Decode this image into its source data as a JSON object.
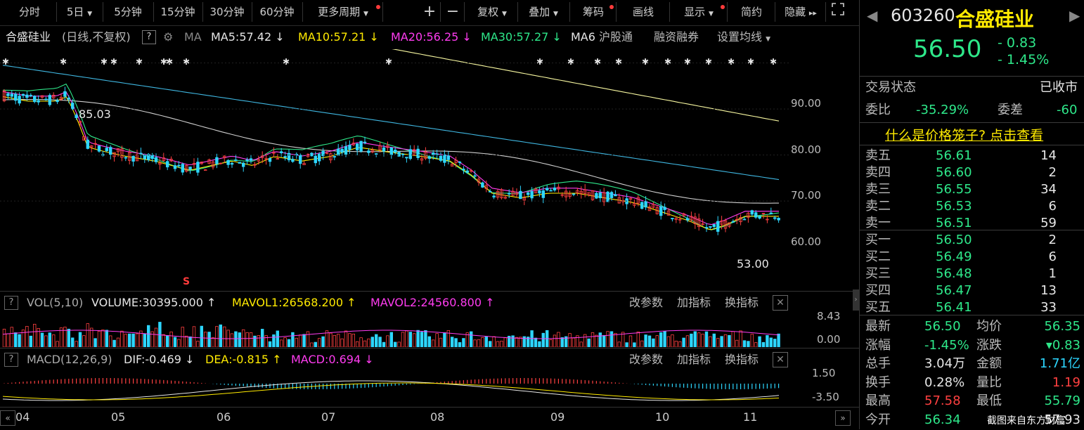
{
  "toolbar": {
    "tabs": [
      "分时",
      "5日",
      "5分钟",
      "15分钟",
      "30分钟",
      "60分钟",
      "更多周期"
    ],
    "actions": [
      "复权",
      "叠加",
      "筹码",
      "画线",
      "显示",
      "简约",
      "隐藏"
    ]
  },
  "ma_bar": {
    "title": "合盛硅业",
    "mode": "(日线,不复权)",
    "ma_label": "MA",
    "ma5": "MA5:57.42",
    "ma10": "MA10:57.21",
    "ma20": "MA20:56.25",
    "ma30": "MA30:57.27",
    "ma6": "MA6",
    "hgt": "沪股通",
    "rzrq": "融资融券",
    "setma": "设置均线"
  },
  "price_axis": [
    "90.00",
    "80.00",
    "70.00",
    "60.00"
  ],
  "annotations": {
    "high": "85.03",
    "low": "53.00",
    "s": "S"
  },
  "vol_panel": {
    "name": "VOL(5,10)",
    "volume": "VOLUME:30395.000",
    "mavol1": "MAVOL1:26568.200",
    "mavol2": "MAVOL2:24560.800",
    "gcs": "改参数",
    "jzb": "加指标",
    "hzb": "换指标",
    "axis": [
      "8.43",
      "0.00"
    ]
  },
  "macd_panel": {
    "name": "MACD(12,26,9)",
    "dif": "DIF:-0.469",
    "dea": "DEA:-0.815",
    "macd": "MACD:0.694",
    "gcs": "改参数",
    "jzb": "加指标",
    "hzb": "换指标",
    "axis": [
      "1.50",
      "-3.50"
    ]
  },
  "x_axis": [
    "04",
    "05",
    "06",
    "07",
    "08",
    "09",
    "10",
    "11"
  ],
  "quote": {
    "code": "603260",
    "name": "合盛硅业",
    "price": "56.50",
    "change": "- 0.83",
    "pct": "- 1.45%",
    "status_label": "交易状态",
    "status": "已收市",
    "wb_label": "委比",
    "wb": "-35.29%",
    "wc_label": "委差",
    "wc": "-60",
    "cage": "什么是价格笼子? 点击查看",
    "sell": [
      {
        "label": "卖五",
        "price": "56.61",
        "vol": "14"
      },
      {
        "label": "卖四",
        "price": "56.60",
        "vol": "2"
      },
      {
        "label": "卖三",
        "price": "56.55",
        "vol": "34"
      },
      {
        "label": "卖二",
        "price": "56.53",
        "vol": "6"
      },
      {
        "label": "卖一",
        "price": "56.51",
        "vol": "59"
      }
    ],
    "buy": [
      {
        "label": "买一",
        "price": "56.50",
        "vol": "2"
      },
      {
        "label": "买二",
        "price": "56.49",
        "vol": "6"
      },
      {
        "label": "买三",
        "price": "56.48",
        "vol": "1"
      },
      {
        "label": "买四",
        "price": "56.47",
        "vol": "13"
      },
      {
        "label": "买五",
        "price": "56.41",
        "vol": "33"
      }
    ],
    "stats": [
      {
        "l1": "最新",
        "v1": "56.50",
        "l2": "均价",
        "v2": "56.35"
      },
      {
        "l1": "涨幅",
        "v1": "-1.45%",
        "l2": "涨跌",
        "v2": "▾0.83"
      },
      {
        "l1": "总手",
        "v1": "3.04万",
        "l2": "金额",
        "v2": "1.71亿"
      },
      {
        "l1": "换手",
        "v1": "0.28%",
        "l2": "量比",
        "v2": "1.19"
      },
      {
        "l1": "最高",
        "v1": "57.58",
        "l2": "最低",
        "v2": "55.79"
      },
      {
        "l1": "今开",
        "v1": "56.34",
        "l2": "",
        "v2": "57.93"
      }
    ]
  },
  "watermark": "截图来自东方财富",
  "colors": {
    "up": "#ff4040",
    "down": "#2dd6ff",
    "green": "#2ee88a",
    "yellow": "#ffea00",
    "magenta": "#ff3cf0"
  }
}
